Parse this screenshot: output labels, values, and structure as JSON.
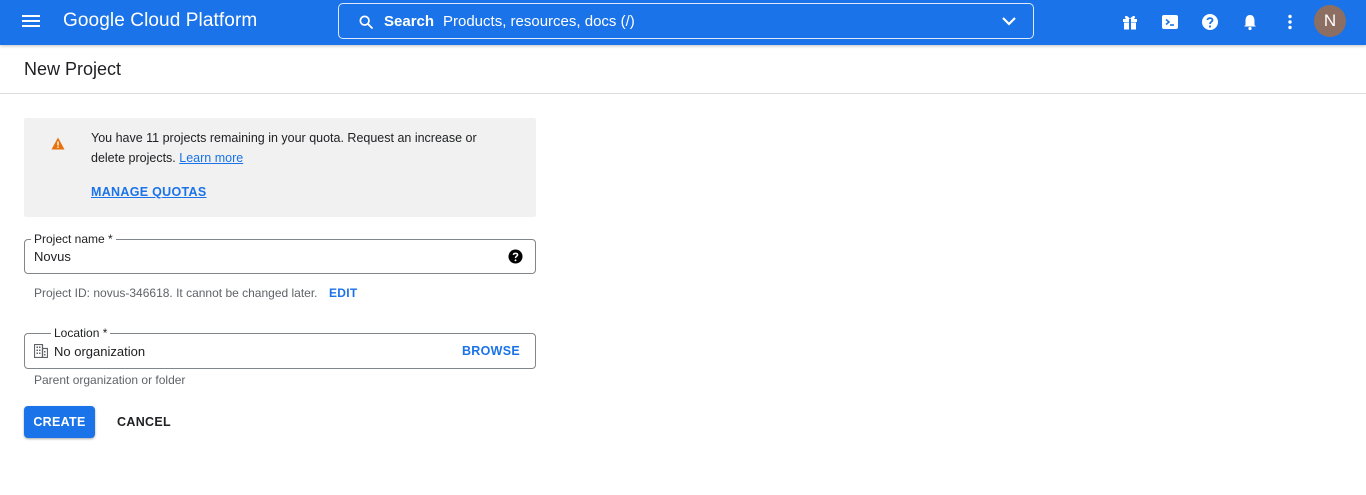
{
  "app": {
    "title": "Google Cloud Platform",
    "brand_color": "#1a73e8"
  },
  "topbar": {
    "menu_icon": "hamburger-menu-icon",
    "search": {
      "label": "Search",
      "placeholder": "Products, resources, docs (/)",
      "icon": "search-icon",
      "expand_icon": "chevron-down-icon"
    },
    "icons": [
      "gift-icon",
      "terminal-icon",
      "help-icon",
      "notifications-bell-icon",
      "more-vert-icon"
    ],
    "avatar_initial": "N"
  },
  "page": {
    "title": "New Project"
  },
  "quota_notice": {
    "icon": "warning-icon",
    "message": "You have 11 projects remaining in your quota. Request an increase or delete projects.",
    "learn_more": "Learn more",
    "manage_quotas": "MANAGE QUOTAS",
    "warning_color": "#e8710a"
  },
  "form": {
    "project_name": {
      "label": "Project name *",
      "value": "Novus",
      "help_icon": "help-circle-icon"
    },
    "project_id_helper": "Project ID: novus-346618. It cannot be changed later.",
    "edit_label": "EDIT",
    "location": {
      "label": "Location *",
      "icon": "building-icon",
      "value": "No organization",
      "browse_label": "BROWSE",
      "helper": "Parent organization or folder"
    }
  },
  "actions": {
    "create_label": "CREATE",
    "cancel_label": "CANCEL"
  }
}
